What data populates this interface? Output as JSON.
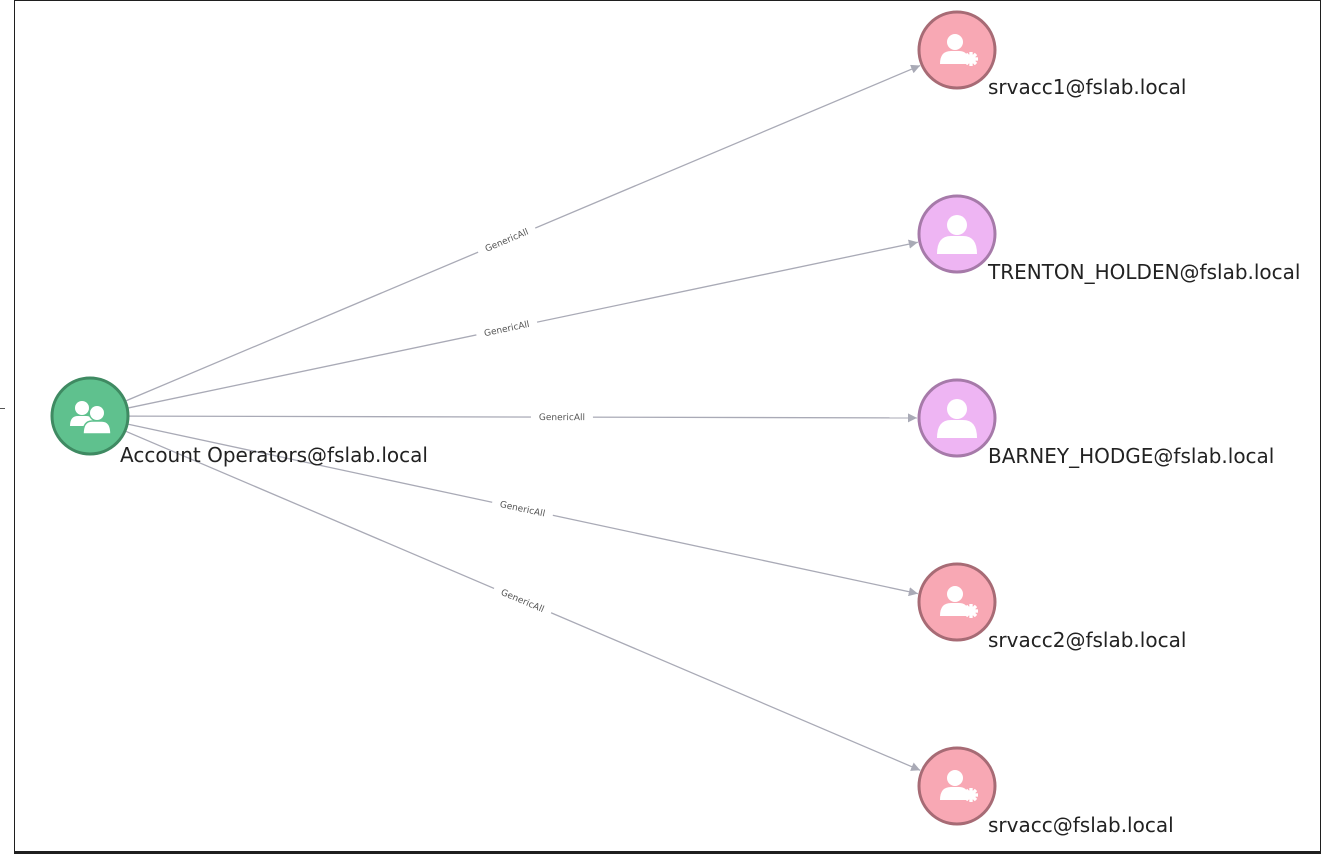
{
  "graph": {
    "source": {
      "id": "account-operators",
      "label": "Account Operators@fslab.local",
      "kind": "group",
      "icon": "group-icon",
      "fill": "#5fc18e",
      "stroke": "#3f8a62"
    },
    "targets": [
      {
        "id": "srvacc1",
        "label": "srvacc1@fslab.local",
        "kind": "service-account",
        "icon": "user-gear-icon",
        "fill": "#f8a8b4",
        "stroke": "#a76b75"
      },
      {
        "id": "trenton-holden",
        "label": "TRENTON_HOLDEN@fslab.local",
        "kind": "user",
        "icon": "user-icon",
        "fill": "#eeb5f3",
        "stroke": "#a67aa9"
      },
      {
        "id": "barney-hodge",
        "label": "BARNEY_HODGE@fslab.local",
        "kind": "user",
        "icon": "user-icon",
        "fill": "#eeb5f3",
        "stroke": "#a67aa9"
      },
      {
        "id": "srvacc2",
        "label": "srvacc2@fslab.local",
        "kind": "service-account",
        "icon": "user-gear-icon",
        "fill": "#f8a8b4",
        "stroke": "#a76b75"
      },
      {
        "id": "srvacc",
        "label": "srvacc@fslab.local",
        "kind": "service-account",
        "icon": "user-gear-icon",
        "fill": "#f8a8b4",
        "stroke": "#a76b75"
      }
    ],
    "edges": [
      {
        "from": "account-operators",
        "to": "srvacc1",
        "label": "GenericAll"
      },
      {
        "from": "account-operators",
        "to": "trenton-holden",
        "label": "GenericAll"
      },
      {
        "from": "account-operators",
        "to": "barney-hodge",
        "label": "GenericAll"
      },
      {
        "from": "account-operators",
        "to": "srvacc2",
        "label": "GenericAll"
      },
      {
        "from": "account-operators",
        "to": "srvacc",
        "label": "GenericAll"
      }
    ],
    "edge_color": "#a9aab6",
    "label_color": "#555555"
  }
}
